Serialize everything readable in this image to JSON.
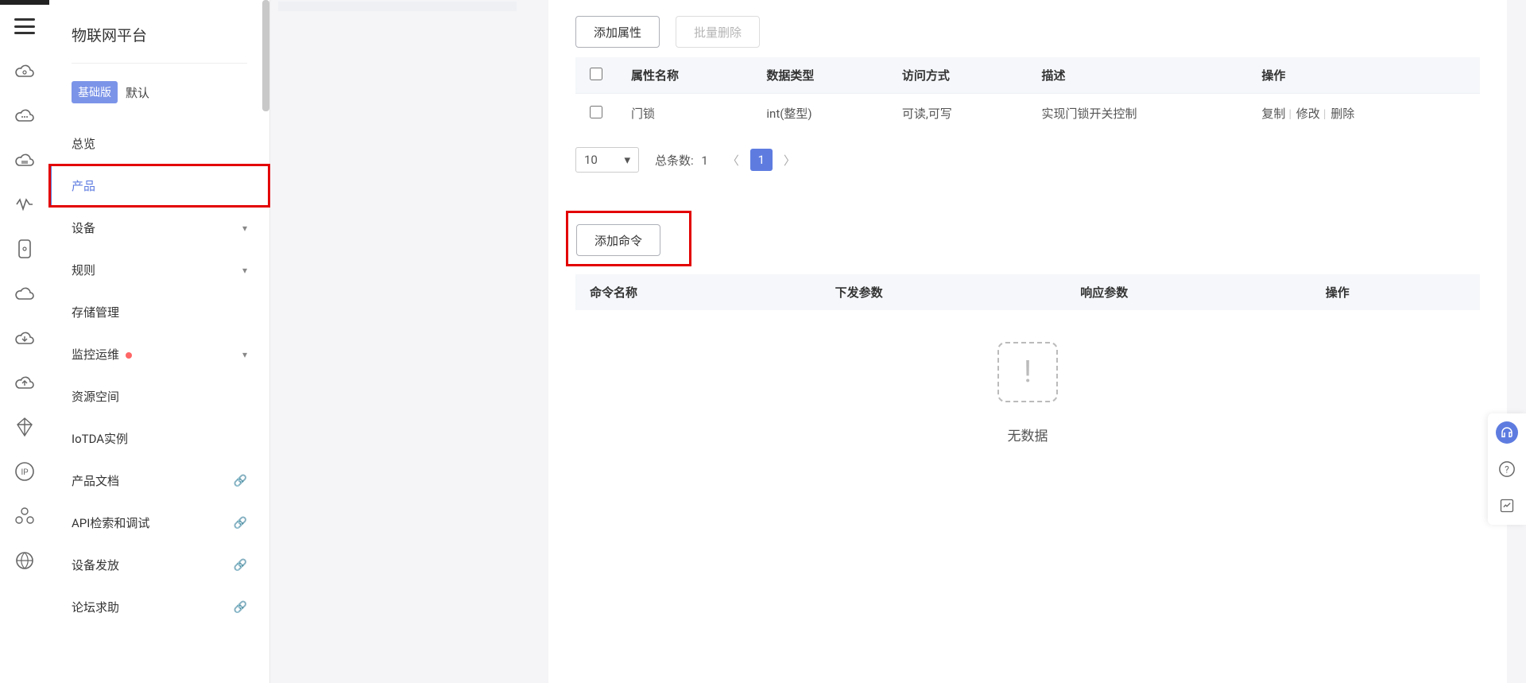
{
  "sidebar": {
    "title": "物联网平台",
    "edition_badge": "基础版",
    "edition_default": "默认",
    "items": {
      "overview": "总览",
      "product": "产品",
      "device": "设备",
      "rule": "规则",
      "storage": "存储管理",
      "monitor": "监控运维",
      "resource_space": "资源空间",
      "iotda_instance": "IoTDA实例",
      "product_doc": "产品文档",
      "api_debug": "API检索和调试",
      "device_dispatch": "设备发放",
      "forum_help": "论坛求助"
    }
  },
  "attributes_section": {
    "btn_add_attr": "添加属性",
    "btn_batch_delete": "批量删除",
    "headers": {
      "name": "属性名称",
      "datatype": "数据类型",
      "access": "访问方式",
      "description": "描述",
      "action": "操作"
    },
    "rows": [
      {
        "name": "门锁",
        "datatype": "int(整型)",
        "access": "可读,可写",
        "description": "实现门锁开关控制"
      }
    ],
    "row_actions": {
      "copy": "复制",
      "modify": "修改",
      "delete": "删除"
    }
  },
  "pagination": {
    "page_size": "10",
    "total_label": "总条数:",
    "total": "1",
    "current": "1"
  },
  "commands_section": {
    "btn_add_cmd": "添加命令",
    "headers": {
      "name": "命令名称",
      "down_params": "下发参数",
      "resp_params": "响应参数",
      "action": "操作"
    },
    "empty": "无数据"
  }
}
